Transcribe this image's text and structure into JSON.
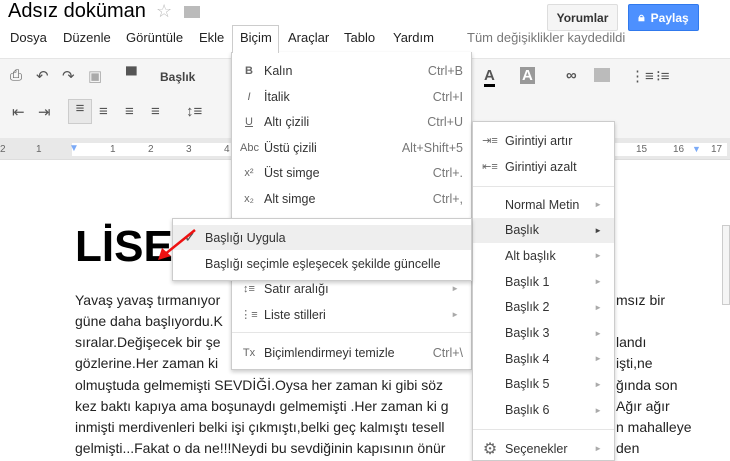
{
  "app": {
    "title": "Adsız doküman",
    "star_icon": "star-icon",
    "folder_icon": "folder-icon"
  },
  "header": {
    "comments": "Yorumlar",
    "share": "Paylaş",
    "share_color": "#4d90fe"
  },
  "menubar": {
    "items": [
      "Dosya",
      "Düzenle",
      "Görüntüle",
      "Ekle",
      "Biçim",
      "Araçlar",
      "Tablo",
      "Yardım"
    ],
    "status": "Tüm değişiklikler kaydedildi"
  },
  "toolbar": {
    "style": "Başlık"
  },
  "ruler": {
    "ticks": [
      "2",
      "1",
      "1",
      "2",
      "3",
      "4",
      "15",
      "16",
      "17"
    ]
  },
  "document": {
    "heading": "LİSE",
    "lines_left": [
      "Yavaş yavaş tırmanıyor",
      "güne daha başlıyordu.K",
      "sıralar.Değişecek bir şe",
      "gözlerine.Her zaman ki",
      "olmuştuda gelmemişti SEVDİĞİ.Oysa her zaman ki gibi söz",
      "kez baktı kapıya ama boşunaydı gelmemişti .Her zaman ki g",
      "inmişti merdivenleri belki işi çıkmıştı,belki geç kalmıştı tesell",
      "gelmişti...Fakat o da ne!!!Neydi bu sevdiğinin kapısının önür"
    ],
    "lines_right": [
      "msız bir",
      "",
      "landı",
      "işti,ne",
      "ğında son",
      "Ağır ağır",
      "n mahalleye",
      "den"
    ]
  },
  "format_menu": {
    "items": [
      {
        "icon": "B",
        "label": "Kalın",
        "shortcut": "Ctrl+B"
      },
      {
        "icon": "I",
        "label": "İtalik",
        "shortcut": "Ctrl+I"
      },
      {
        "icon": "U",
        "label": "Altı çizili",
        "shortcut": "Ctrl+U"
      },
      {
        "icon": "Abc",
        "label": "Üstü çizili",
        "shortcut": "Alt+Shift+5"
      },
      {
        "icon": "x²",
        "label": "Üst simge",
        "shortcut": "Ctrl+."
      },
      {
        "icon": "x₂",
        "label": "Alt simge",
        "shortcut": "Ctrl+,"
      },
      {
        "icon": "↕≡",
        "label": "Satır aralığı",
        "shortcut": ""
      },
      {
        "icon": "⋮≡",
        "label": "Liste stilleri",
        "shortcut": ""
      },
      {
        "icon": "Tx",
        "label": "Biçimlendirmeyi temizle",
        "shortcut": "Ctrl+\\"
      }
    ]
  },
  "paragraph_menu": {
    "indent": [
      "Girintiyi artır",
      "Girintiyi azalt"
    ],
    "styles": [
      "Normal Metin",
      "Başlık",
      "Alt başlık",
      "Başlık 1",
      "Başlık 2",
      "Başlık 3",
      "Başlık 4",
      "Başlık 5",
      "Başlık 6"
    ],
    "options": "Seçenekler"
  },
  "heading_menu": {
    "apply": "Başlığı Uygula",
    "update": "Başlığı seçimle eşleşecek şekilde güncelle"
  }
}
